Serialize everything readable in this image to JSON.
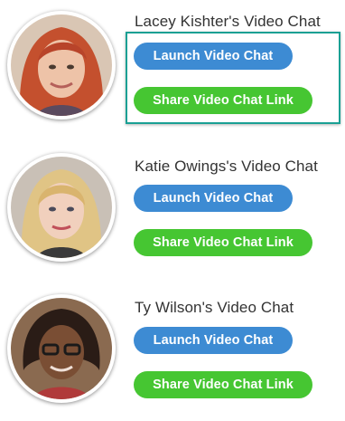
{
  "chats": [
    {
      "title": "Lacey Kishter's Video Chat",
      "launch_label": "Launch Video Chat",
      "share_label": "Share Video Chat Link"
    },
    {
      "title": "Katie Owings's Video Chat",
      "launch_label": "Launch Video Chat",
      "share_label": "Share Video Chat Link"
    },
    {
      "title": "Ty Wilson's Video Chat",
      "launch_label": "Launch Video Chat",
      "share_label": "Share Video Chat Link"
    }
  ],
  "colors": {
    "launch_button": "#3d8bd3",
    "share_button": "#46c632",
    "highlight_border": "#1aa094",
    "title_text": "#333333"
  }
}
